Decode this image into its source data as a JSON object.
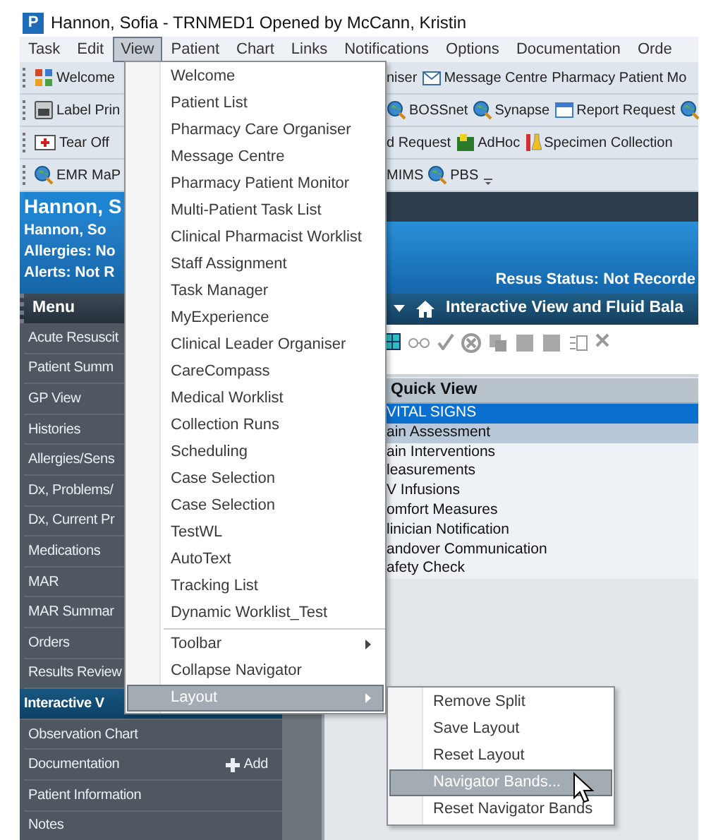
{
  "window": {
    "logo": "P",
    "title": "Hannon, Sofia   - TRNMED1 Opened by McCann, Kristin"
  },
  "menubar": [
    {
      "label": "Task",
      "selected": false
    },
    {
      "label": "Edit",
      "selected": false
    },
    {
      "label": "View",
      "selected": true
    },
    {
      "label": "Patient",
      "selected": false
    },
    {
      "label": "Chart",
      "selected": false
    },
    {
      "label": "Links",
      "selected": false
    },
    {
      "label": "Notifications",
      "selected": false
    },
    {
      "label": "Options",
      "selected": false
    },
    {
      "label": "Documentation",
      "selected": false
    },
    {
      "label": "Orde",
      "selected": false
    }
  ],
  "toolbars": [
    {
      "left": [
        {
          "kind": "tiles",
          "label": "Welcome"
        }
      ],
      "right": [
        {
          "kind": "text",
          "label": "niser"
        },
        {
          "kind": "envelope",
          "label": "Message Centre"
        },
        {
          "kind": "text",
          "label": "Pharmacy Patient Mo"
        }
      ]
    },
    {
      "left": [
        {
          "kind": "printer",
          "label": "Label Prin"
        }
      ],
      "right": [
        {
          "kind": "globe",
          "label": "BOSSnet"
        },
        {
          "kind": "globe",
          "label": "Synapse"
        },
        {
          "kind": "form",
          "label": "Report Request"
        },
        {
          "kind": "globe"
        }
      ]
    },
    {
      "left": [
        {
          "kind": "tearoff",
          "label": "Tear Off"
        }
      ],
      "right": [
        {
          "kind": "text",
          "label": "d Request"
        },
        {
          "kind": "adhoc",
          "label": "AdHoc"
        },
        {
          "kind": "flask",
          "label": "Specimen Collection"
        }
      ]
    },
    {
      "left": [
        {
          "kind": "globe",
          "label": "EMR MaP"
        }
      ],
      "right": [
        {
          "kind": "text",
          "label": "MIMS"
        },
        {
          "kind": "globe",
          "label": "PBS"
        },
        {
          "kind": "overflow"
        }
      ]
    }
  ],
  "banner": {
    "name": "Hannon, S",
    "name_line": "Hannon, So",
    "allergies": "Allergies: No",
    "alerts": "Alerts: Not R",
    "resus": "Resus Status: Not Recorde"
  },
  "sidebar": {
    "header": "Menu",
    "items": [
      {
        "label": "Acute Resuscit",
        "selected": false
      },
      {
        "label": "Patient Summ",
        "selected": false
      },
      {
        "label": "GP View",
        "selected": false
      },
      {
        "label": "Histories",
        "selected": false
      },
      {
        "label": "Allergies/Sens",
        "selected": false
      },
      {
        "label": "Dx, Problems/",
        "selected": false
      },
      {
        "label": "Dx, Current Pr",
        "selected": false
      },
      {
        "label": "Medications",
        "selected": false
      },
      {
        "label": "MAR",
        "selected": false
      },
      {
        "label": "MAR Summar",
        "selected": false
      },
      {
        "label": "Orders",
        "selected": false
      },
      {
        "label": "Results Review",
        "selected": false
      },
      {
        "label": "Interactive V",
        "selected": true
      },
      {
        "label": "Observation Chart",
        "selected": false
      },
      {
        "label": "Documentation",
        "selected": false,
        "action": "Add"
      },
      {
        "label": "Patient Information",
        "selected": false
      },
      {
        "label": "Notes",
        "selected": false
      }
    ]
  },
  "content": {
    "title": "Interactive View and Fluid Bala",
    "toolbar_icons": [
      {
        "kind": "grid"
      },
      {
        "kind": "glasses"
      },
      {
        "kind": "check"
      },
      {
        "kind": "cancel"
      },
      {
        "kind": "copy"
      },
      {
        "kind": "square"
      },
      {
        "kind": "square"
      },
      {
        "kind": "list"
      },
      {
        "kind": "close"
      }
    ],
    "quick_view": {
      "header": "Quick View",
      "rows": [
        {
          "label": "VITAL SIGNS",
          "selected": true,
          "highlighted": false
        },
        {
          "label": "ain Assessment",
          "selected": false,
          "highlighted": true
        },
        {
          "label": "ain Interventions",
          "selected": false,
          "highlighted": false
        },
        {
          "label": "leasurements",
          "selected": false,
          "highlighted": false
        },
        {
          "label": "V Infusions",
          "selected": false,
          "highlighted": false
        },
        {
          "label": "omfort Measures",
          "selected": false,
          "highlighted": false
        },
        {
          "label": "linician Notification",
          "selected": false,
          "highlighted": false
        },
        {
          "label": "andover Communication",
          "selected": false,
          "highlighted": false
        },
        {
          "label": "afety Check",
          "selected": false,
          "highlighted": false
        }
      ]
    }
  },
  "view_menu": [
    {
      "label": "Welcome",
      "selected": false
    },
    {
      "label": "Patient List",
      "selected": false
    },
    {
      "label": "Pharmacy Care Organiser",
      "selected": false
    },
    {
      "label": "Message Centre",
      "selected": false
    },
    {
      "label": "Pharmacy Patient Monitor",
      "selected": false
    },
    {
      "label": "Multi-Patient Task List",
      "selected": false
    },
    {
      "label": "Clinical Pharmacist Worklist",
      "selected": false
    },
    {
      "label": "Staff Assignment",
      "selected": false
    },
    {
      "label": "Task Manager",
      "selected": false
    },
    {
      "label": "MyExperience",
      "selected": false
    },
    {
      "label": "Clinical Leader Organiser",
      "selected": false
    },
    {
      "label": "CareCompass",
      "selected": false
    },
    {
      "label": "Medical Worklist",
      "selected": false
    },
    {
      "label": "Collection Runs",
      "selected": false
    },
    {
      "label": "Scheduling",
      "selected": false
    },
    {
      "label": "Case Selection",
      "selected": false
    },
    {
      "label": "Case Selection",
      "selected": false
    },
    {
      "label": "TestWL",
      "selected": false
    },
    {
      "label": "AutoText",
      "selected": false
    },
    {
      "label": "Tracking List",
      "selected": false
    },
    {
      "label": "Dynamic Worklist_Test",
      "selected": false
    },
    {
      "label": "Toolbar",
      "selected": false,
      "submenu": true,
      "separator_before": true
    },
    {
      "label": "Collapse Navigator",
      "selected": false
    },
    {
      "label": "Layout",
      "selected": true,
      "submenu": true
    }
  ],
  "layout_menu": [
    {
      "label": "Remove Split",
      "selected": false
    },
    {
      "label": "Save Layout",
      "selected": false
    },
    {
      "label": "Reset Layout",
      "selected": false
    },
    {
      "label": "Navigator Bands...",
      "selected": true
    },
    {
      "label": "Reset Navigator Bands",
      "selected": false
    }
  ]
}
